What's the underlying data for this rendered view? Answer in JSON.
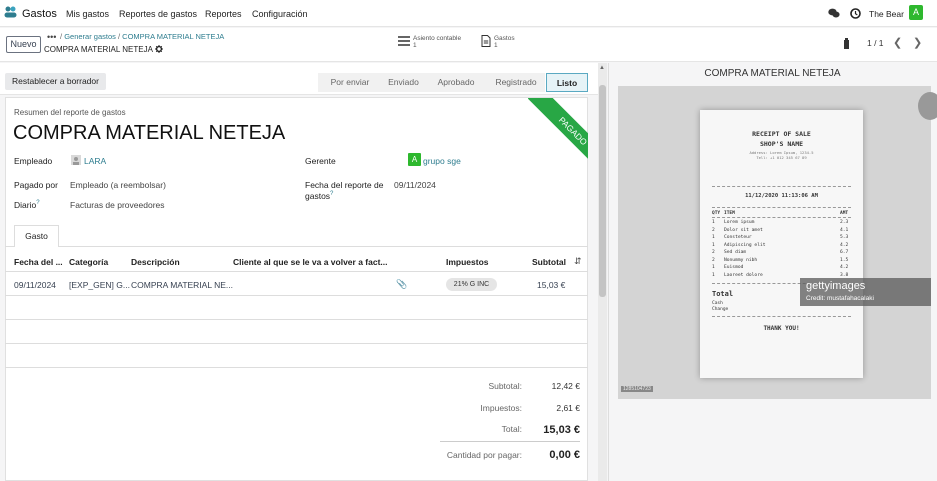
{
  "nav": {
    "app_title": "Gastos",
    "menu": [
      "Mis gastos",
      "Reportes de gastos",
      "Reportes",
      "Configuración"
    ],
    "user_name": "The Bear",
    "user_initial": "A"
  },
  "control": {
    "new_label": "Nuevo",
    "breadcrumb_dots": "•••",
    "breadcrumb_sep": "/",
    "breadcrumb_parent": "Generar gastos",
    "breadcrumb_current": "COMPRA MATERIAL NETEJA",
    "record_title": "COMPRA MATERIAL NETEJA",
    "smart_buttons": [
      {
        "label": "Asiento contable",
        "count": "1"
      },
      {
        "label": "Gastos",
        "count": "1"
      }
    ],
    "pager": "1 / 1"
  },
  "status": {
    "reset_label": "Restablecer a borrador",
    "stages": [
      "Por enviar",
      "Enviado",
      "Aprobado",
      "Registrado",
      "Listo"
    ],
    "active_stage": "Listo"
  },
  "form": {
    "subtitle": "Resumen del reporte de gastos",
    "title": "COMPRA MATERIAL NETEJA",
    "ribbon": "PAGADO",
    "employee_label": "Empleado",
    "employee_value": "LARA",
    "paid_by_label": "Pagado por",
    "paid_by_value": "Empleado (a reembolsar)",
    "journal_label": "Diario",
    "journal_value": "Facturas de proveedores",
    "manager_label": "Gerente",
    "manager_initial": "A",
    "manager_value": "grupo sge",
    "report_date_label_1": "Fecha del reporte de",
    "report_date_label_2": "gastos",
    "report_date_value": "09/11/2024",
    "tab": "Gasto"
  },
  "table": {
    "headers": [
      "Fecha del ...",
      "Categoría",
      "Descripción",
      "Cliente al que se le va a volver a fact...",
      "Impuestos",
      "Subtotal"
    ],
    "rows": [
      {
        "date": "09/11/2024",
        "category": "[EXP_GEN] G...",
        "description": "COMPRA MATERIAL NE...",
        "client": "",
        "tax": "21% G INC",
        "subtotal": "15,03 €"
      }
    ]
  },
  "totals": {
    "subtotal_label": "Subtotal:",
    "subtotal_value": "12,42 €",
    "taxes_label": "Impuestos:",
    "taxes_value": "2,61 €",
    "total_label": "Total:",
    "total_value": "15,03 €",
    "due_label": "Cantidad por pagar:",
    "due_value": "0,00 €"
  },
  "attachment": {
    "title": "COMPRA MATERIAL NETEJA",
    "receipt": {
      "header1": "RECEIPT OF SALE",
      "header2": "SHOP'S NAME",
      "address1": "Address: Lorem Ipsum, 1234-5",
      "address2": "Tell: +1 012 345 67 89",
      "datetime": "11/12/2020  11:13:06 AM",
      "col_qty": "QTY",
      "col_item": "ITEM",
      "col_amt": "AMT",
      "items": [
        {
          "qty": "1",
          "item": "Lorem ipsum",
          "amt": "2.3"
        },
        {
          "qty": "2",
          "item": "Dolor sit amet",
          "amt": "4.1"
        },
        {
          "qty": "1",
          "item": "Consteteur",
          "amt": "5.3"
        },
        {
          "qty": "1",
          "item": "Adipiscing elit",
          "amt": "4.2"
        },
        {
          "qty": "2",
          "item": "Sed diam",
          "amt": "6.7"
        },
        {
          "qty": "2",
          "item": "Nonummy nibh",
          "amt": "1.5"
        },
        {
          "qty": "1",
          "item": "Euismod",
          "amt": "4.2"
        },
        {
          "qty": "1",
          "item": "Laoreet dolore",
          "amt": "3.8"
        }
      ],
      "total_label": "Total",
      "cash_label": "Cash",
      "change_label": "Change",
      "thanks": "THANK YOU!"
    },
    "watermark_brand": "gettyimages",
    "watermark_credit": "Credit: mustafahacalaki",
    "image_id": "1285104723"
  }
}
